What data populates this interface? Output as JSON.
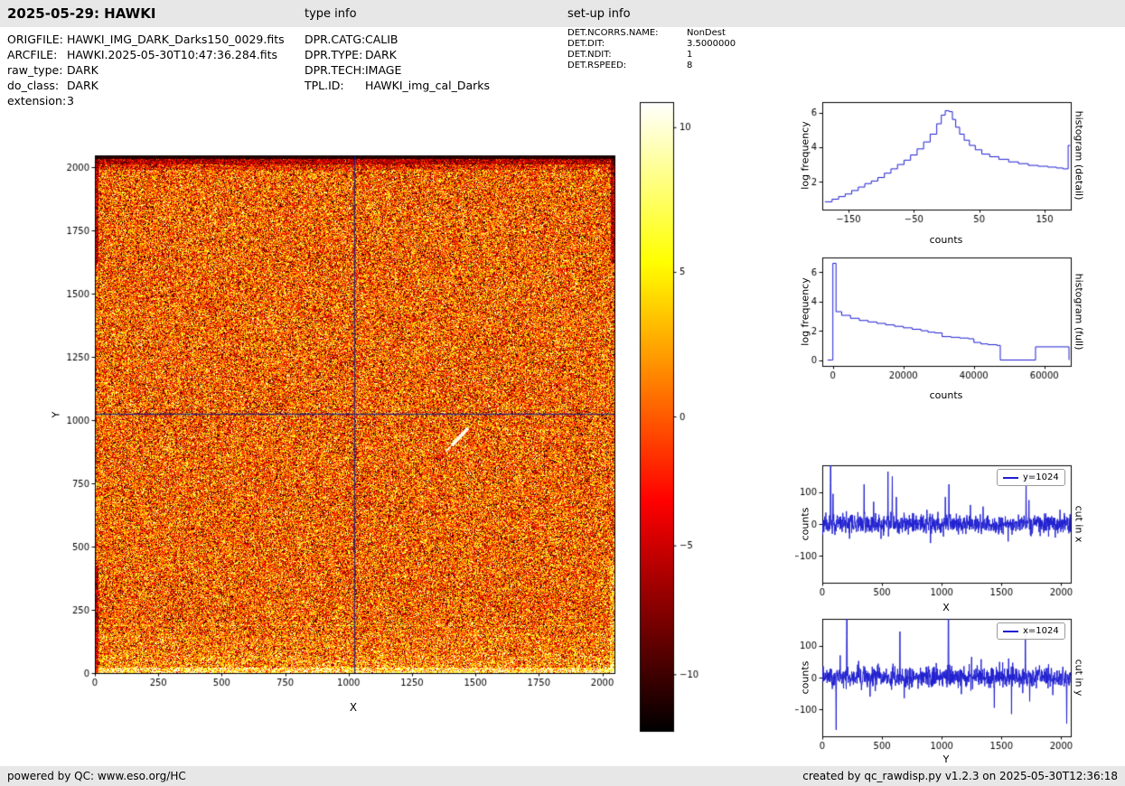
{
  "header": {
    "title": "2025-05-29: HAWKI",
    "type_info": "type info",
    "setup_info": "set-up info"
  },
  "meta": {
    "left": [
      {
        "label": "ORIGFILE:",
        "value": "HAWKI_IMG_DARK_Darks150_0029.fits"
      },
      {
        "label": "ARCFILE:",
        "value": "HAWKI.2025-05-30T10:47:36.284.fits"
      },
      {
        "label": "raw_type:",
        "value": "DARK"
      },
      {
        "label": "do_class:",
        "value": "DARK"
      },
      {
        "label": "extension:",
        "value": "3"
      }
    ],
    "middle": [
      {
        "label": "DPR.CATG:",
        "value": "CALIB"
      },
      {
        "label": "DPR.TYPE:",
        "value": "DARK"
      },
      {
        "label": "DPR.TECH:",
        "value": "IMAGE"
      },
      {
        "label": "TPL.ID:",
        "value": "HAWKI_img_cal_Darks"
      }
    ],
    "right": [
      {
        "label": "DET.NCORRS.NAME:",
        "value": "NonDest"
      },
      {
        "label": "DET.DIT:",
        "value": "3.5000000"
      },
      {
        "label": "DET.NDIT:",
        "value": "1"
      },
      {
        "label": "DET.RSPEED:",
        "value": "8"
      }
    ]
  },
  "colorbar": {
    "ticks": [
      {
        "label": "10",
        "f": 0.04
      },
      {
        "label": "5",
        "f": 0.27
      },
      {
        "label": "0",
        "f": 0.5
      },
      {
        "label": "-5",
        "f": 0.705
      },
      {
        "label": "-10",
        "f": 0.91
      }
    ]
  },
  "colors": {
    "line": "#1f1fd0",
    "crosshair": "#1b1b7e",
    "bar_bg": "#e7e7e7"
  },
  "footer": {
    "left": "powered by QC: www.eso.org/HC",
    "right": "created by qc_rawdisp.py v1.2.3 on 2025-05-30T12:36:18"
  },
  "chart_data": [
    {
      "type": "heatmap",
      "name": "raw-dark-frame-image",
      "xlabel": "X",
      "ylabel": "Y",
      "xlim": [
        0,
        2048
      ],
      "ylim": [
        0,
        2048
      ],
      "xticks": [
        0,
        250,
        500,
        750,
        1000,
        1250,
        1500,
        1750,
        2000
      ],
      "yticks": [
        0,
        250,
        500,
        750,
        1000,
        1250,
        1500,
        1750,
        2000
      ],
      "colormap": "hot",
      "value_range": [
        -12,
        12
      ],
      "crosshair": {
        "x": 1024,
        "y": 1024
      },
      "noise": {
        "mean": 0,
        "sigma": 5
      },
      "features": [
        {
          "name": "bright-streak",
          "x": 1430,
          "y": 950
        },
        {
          "name": "dark-top-edge"
        },
        {
          "name": "bright-bottom-edge"
        }
      ]
    },
    {
      "type": "line",
      "mode": "steps",
      "xlabel": "counts",
      "ylabel": "log frequency",
      "side_label": "histogram (detail)",
      "xlim": [
        -190,
        190
      ],
      "ylim": [
        0.4,
        6.6
      ],
      "xticks": [
        -150,
        -50,
        50,
        150
      ],
      "yticks": [
        2,
        4,
        6
      ],
      "points": [
        [
          -186,
          0.85
        ],
        [
          -175,
          1.0
        ],
        [
          -165,
          1.15
        ],
        [
          -155,
          1.3
        ],
        [
          -145,
          1.5
        ],
        [
          -135,
          1.7
        ],
        [
          -125,
          1.9
        ],
        [
          -115,
          2.05
        ],
        [
          -105,
          2.25
        ],
        [
          -95,
          2.5
        ],
        [
          -85,
          2.75
        ],
        [
          -75,
          3.0
        ],
        [
          -65,
          3.25
        ],
        [
          -55,
          3.55
        ],
        [
          -45,
          3.9
        ],
        [
          -35,
          4.3
        ],
        [
          -25,
          4.75
        ],
        [
          -15,
          5.35
        ],
        [
          -8,
          5.85
        ],
        [
          -2,
          6.1
        ],
        [
          4,
          6.05
        ],
        [
          9,
          5.6
        ],
        [
          14,
          5.15
        ],
        [
          20,
          4.75
        ],
        [
          27,
          4.4
        ],
        [
          35,
          4.1
        ],
        [
          44,
          3.85
        ],
        [
          54,
          3.6
        ],
        [
          66,
          3.45
        ],
        [
          80,
          3.3
        ],
        [
          95,
          3.15
        ],
        [
          110,
          3.05
        ],
        [
          125,
          2.95
        ],
        [
          140,
          2.9
        ],
        [
          155,
          2.85
        ],
        [
          168,
          2.8
        ],
        [
          178,
          2.75
        ],
        [
          186,
          4.1
        ],
        [
          189,
          4.1
        ]
      ]
    },
    {
      "type": "line",
      "mode": "steps",
      "xlabel": "counts",
      "ylabel": "log frequency",
      "side_label": "histogram (full)",
      "xlim": [
        -3000,
        67500
      ],
      "ylim": [
        -0.4,
        7.0
      ],
      "xticks": [
        0,
        20000,
        40000,
        60000
      ],
      "yticks": [
        0,
        2,
        4,
        6
      ],
      "points": [
        [
          -1500,
          0
        ],
        [
          -200,
          0
        ],
        [
          0,
          6.6
        ],
        [
          900,
          3.3
        ],
        [
          2500,
          3.05
        ],
        [
          5000,
          2.85
        ],
        [
          7500,
          2.7
        ],
        [
          10000,
          2.6
        ],
        [
          12500,
          2.5
        ],
        [
          15000,
          2.4
        ],
        [
          17500,
          2.3
        ],
        [
          20000,
          2.2
        ],
        [
          22500,
          2.1
        ],
        [
          25000,
          2.0
        ],
        [
          27000,
          1.9
        ],
        [
          29000,
          1.85
        ],
        [
          31000,
          1.6
        ],
        [
          33500,
          1.55
        ],
        [
          36000,
          1.5
        ],
        [
          38500,
          1.45
        ],
        [
          40000,
          1.2
        ],
        [
          42000,
          1.1
        ],
        [
          44000,
          1.05
        ],
        [
          46500,
          1.0
        ],
        [
          47500,
          0
        ],
        [
          56500,
          0
        ],
        [
          57500,
          0.9
        ],
        [
          66500,
          0.9
        ],
        [
          67000,
          0
        ]
      ]
    },
    {
      "type": "line",
      "mode": "noise",
      "legend": "y=1024",
      "xlabel": "X",
      "ylabel": "counts",
      "side_label": "cut in x",
      "xlim": [
        0,
        2080
      ],
      "ylim": [
        -185,
        185
      ],
      "xticks": [
        0,
        500,
        1000,
        1500,
        2000
      ],
      "yticks": [
        -100,
        0,
        100
      ],
      "noise_sigma": 15,
      "seed": 11,
      "spikes": [
        [
          70,
          520
        ],
        [
          90,
          95
        ],
        [
          350,
          125
        ],
        [
          430,
          70
        ],
        [
          550,
          165
        ],
        [
          585,
          150
        ],
        [
          620,
          85
        ],
        [
          905,
          -60
        ],
        [
          1030,
          85
        ],
        [
          1060,
          125
        ],
        [
          1240,
          60
        ],
        [
          1345,
          55
        ],
        [
          1555,
          -55
        ],
        [
          1705,
          165
        ],
        [
          1730,
          75
        ],
        [
          1990,
          45
        ]
      ]
    },
    {
      "type": "line",
      "mode": "noise",
      "legend": "x=1024",
      "xlabel": "Y",
      "ylabel": "counts",
      "side_label": "cut in y",
      "xlim": [
        0,
        2080
      ],
      "ylim": [
        -185,
        185
      ],
      "xticks": [
        0,
        500,
        1000,
        1500,
        2000
      ],
      "yticks": [
        -100,
        0,
        100
      ],
      "noise_sigma": 16,
      "seed": 23,
      "spikes": [
        [
          115,
          -165
        ],
        [
          150,
          70
        ],
        [
          205,
          520
        ],
        [
          400,
          -60
        ],
        [
          650,
          145
        ],
        [
          685,
          -65
        ],
        [
          1055,
          520
        ],
        [
          1250,
          65
        ],
        [
          1440,
          -95
        ],
        [
          1560,
          60
        ],
        [
          1700,
          145
        ],
        [
          1735,
          -75
        ],
        [
          1930,
          -55
        ],
        [
          2045,
          -145
        ]
      ]
    }
  ]
}
